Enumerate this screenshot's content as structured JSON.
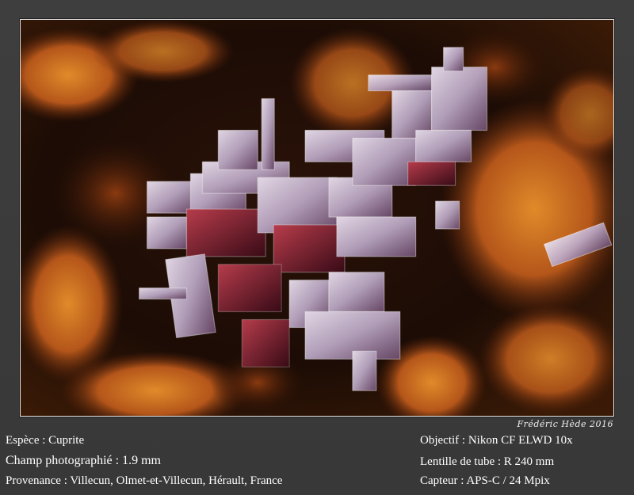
{
  "photo": {
    "subject": "crystal-photomicrograph",
    "signature": "Frédéric Hède 2016"
  },
  "captions": {
    "espece": "Espèce : Cuprite",
    "champ": "Champ photographié : 1.9 mm",
    "provenance": "Provenance : Villecun, Olmet-et-Villecun, Hérault, France",
    "objectif": "Objectif : Nikon CF ELWD 10x",
    "lentille": "Lentille de tube : R 240 mm",
    "capteur": "Capteur : APS-C / 24 Mpix"
  },
  "colors": {
    "background": "#3a3a3a",
    "frame_border": "#e8e8e8",
    "text": "#ffffff",
    "matrix_orange": "#c8641a",
    "crystal": "#c9b9cf"
  }
}
